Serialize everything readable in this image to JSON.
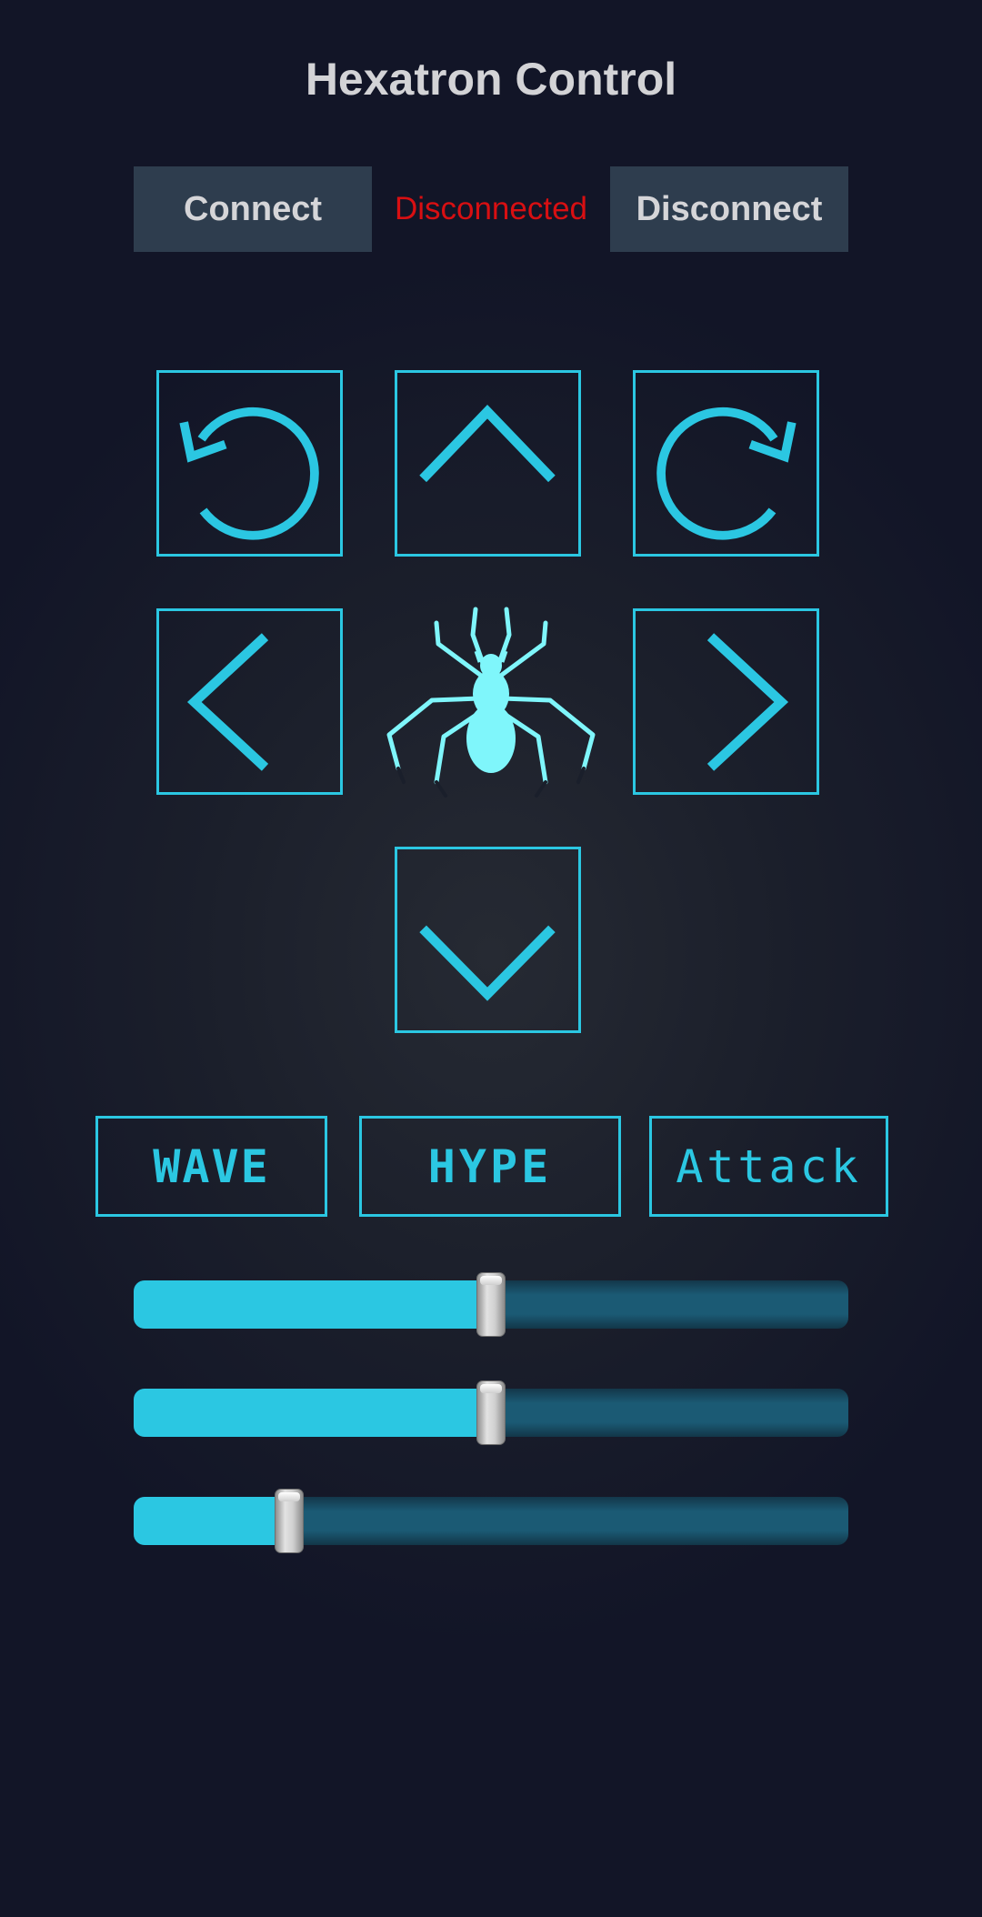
{
  "header": {
    "title": "Hexatron Control"
  },
  "connection": {
    "connect_label": "Connect",
    "status_text": "Disconnected",
    "disconnect_label": "Disconnect",
    "status_color": "#d80f12"
  },
  "controls": {
    "dpad": {
      "rotate_left_icon": "rotate-ccw-icon",
      "forward_icon": "chevron-up-icon",
      "rotate_right_icon": "rotate-cw-icon",
      "left_icon": "chevron-left-icon",
      "center_icon": "spider-icon",
      "right_icon": "chevron-right-icon",
      "backward_icon": "chevron-down-icon"
    },
    "accent_color": "#2bc7e2"
  },
  "actions": {
    "wave_label": "WAVE",
    "hype_label": "HYPE",
    "attack_label": "Attack"
  },
  "sliders": [
    {
      "value": 0.5
    },
    {
      "value": 0.5
    },
    {
      "value": 0.217
    }
  ]
}
